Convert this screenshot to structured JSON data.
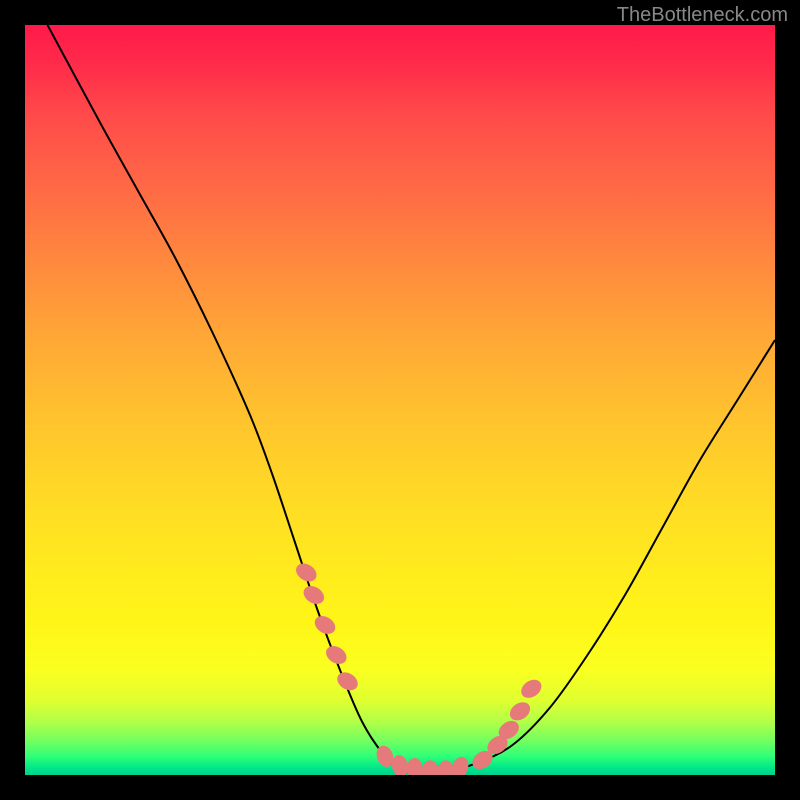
{
  "watermark": "TheBottleneck.com",
  "chart_data": {
    "type": "line",
    "title": "",
    "xlabel": "",
    "ylabel": "",
    "xlim": [
      0,
      100
    ],
    "ylim": [
      0,
      100
    ],
    "series": [
      {
        "name": "curve",
        "x": [
          3,
          10,
          15,
          20,
          25,
          30,
          33,
          36,
          39,
          42,
          45,
          48,
          50,
          53,
          56,
          60,
          65,
          70,
          75,
          80,
          85,
          90,
          95,
          100
        ],
        "values": [
          100,
          87,
          78,
          69,
          59,
          48,
          40,
          31,
          22,
          14,
          7,
          2.5,
          1,
          0.5,
          0.5,
          1.5,
          4,
          9,
          16,
          24,
          33,
          42,
          50,
          58
        ]
      }
    ],
    "markers": {
      "name": "highlight-points",
      "color": "#e67a7a",
      "x": [
        37.5,
        38.5,
        40.0,
        41.5,
        43.0,
        48.0,
        50.0,
        52.0,
        54.0,
        56.0,
        58.0,
        61.0,
        63.0,
        64.5,
        66.0,
        67.5
      ],
      "values": [
        27.0,
        24.0,
        20.0,
        16.0,
        12.5,
        2.5,
        1.2,
        0.8,
        0.5,
        0.5,
        1.0,
        2.0,
        4.0,
        6.0,
        8.5,
        11.5
      ]
    },
    "gradient_stops": [
      {
        "pos": 0,
        "color": "#ff1a4a"
      },
      {
        "pos": 0.5,
        "color": "#ffc22e"
      },
      {
        "pos": 0.85,
        "color": "#fff618"
      },
      {
        "pos": 1.0,
        "color": "#00d090"
      }
    ]
  }
}
